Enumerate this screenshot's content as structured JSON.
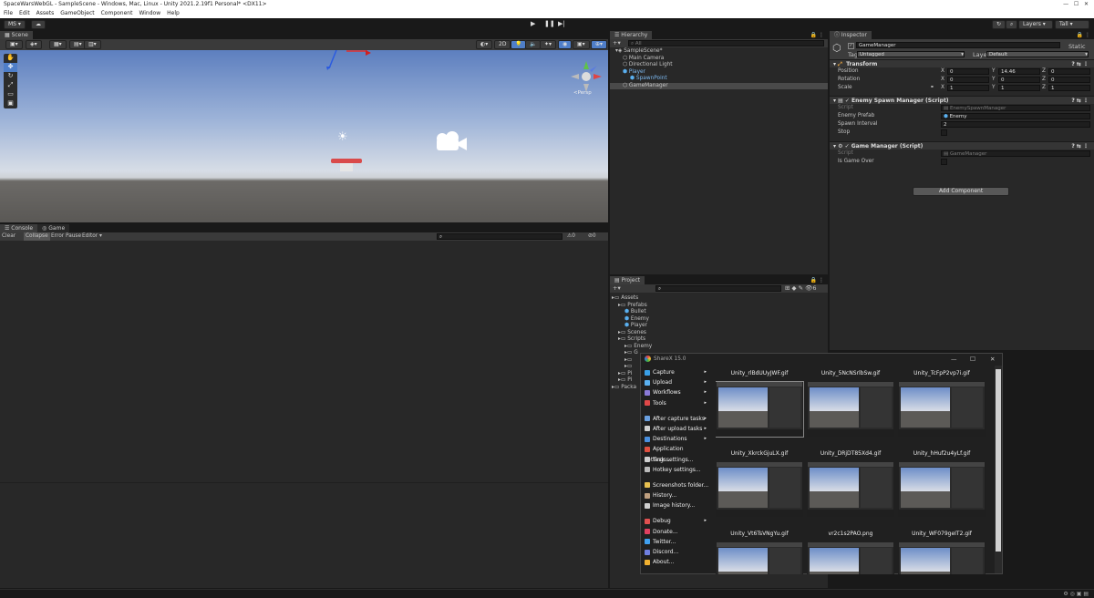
{
  "window": {
    "title": "SpaceWarsWebGL - SampleScene - Windows, Mac, Linux - Unity 2021.2.19f1 Personal* <DX11>"
  },
  "menubar": [
    "File",
    "Edit",
    "Assets",
    "GameObject",
    "Component",
    "Window",
    "Help"
  ],
  "toolbar": {
    "account": "MS",
    "layers": "Layers",
    "layout": "Tall"
  },
  "scene": {
    "tab": "Scene",
    "persp_label": "<Persp",
    "mode_2d": "2D",
    "gizmo_count": "6"
  },
  "console": {
    "tabs": [
      "Console",
      "Game"
    ],
    "buttons": [
      "Clear",
      "Collapse",
      "Error Pause",
      "Editor"
    ],
    "warn_count": "0",
    "error_count": "0"
  },
  "hierarchy": {
    "tab": "Hierarchy",
    "search_placeholder": "All",
    "items": [
      {
        "label": "SampleScene*",
        "indent": 0,
        "selected": false
      },
      {
        "label": "Main Camera",
        "indent": 1,
        "selected": false
      },
      {
        "label": "Directional Light",
        "indent": 1,
        "selected": false
      },
      {
        "label": "Player",
        "indent": 1,
        "selected": false,
        "prefab": true
      },
      {
        "label": "SpawnPoint",
        "indent": 2,
        "selected": false,
        "prefab": true
      },
      {
        "label": "GameManager",
        "indent": 1,
        "selected": true
      }
    ]
  },
  "project": {
    "tab": "Project",
    "badge": "6",
    "items": [
      {
        "label": "Assets",
        "indent": 0
      },
      {
        "label": "Prefabs",
        "indent": 1
      },
      {
        "label": "Bullet",
        "indent": 2
      },
      {
        "label": "Enemy",
        "indent": 2
      },
      {
        "label": "Player",
        "indent": 2
      },
      {
        "label": "Scenes",
        "indent": 1
      },
      {
        "label": "Scripts",
        "indent": 1
      },
      {
        "label": "Enemy",
        "indent": 2
      },
      {
        "label": "G",
        "indent": 2
      },
      {
        "label": "",
        "indent": 2
      },
      {
        "label": "",
        "indent": 2
      },
      {
        "label": "Pi",
        "indent": 1
      },
      {
        "label": "Pi",
        "indent": 1
      },
      {
        "label": "Packa",
        "indent": 0
      }
    ]
  },
  "inspector": {
    "tab": "Inspector",
    "object_name": "GameManager",
    "static_label": "Static",
    "tag_label": "Tag",
    "tag_value": "Untagged",
    "layer_label": "Layer",
    "layer_value": "Default",
    "transform": {
      "title": "Transform",
      "position": {
        "label": "Position",
        "x": "0",
        "y": "14.46",
        "z": "0"
      },
      "rotation": {
        "label": "Rotation",
        "x": "0",
        "y": "0",
        "z": "0"
      },
      "scale": {
        "label": "Scale",
        "x": "1",
        "y": "1",
        "z": "1"
      }
    },
    "enemy_spawn": {
      "title": "Enemy Spawn Manager (Script)",
      "script_label": "Script",
      "script_value": "EnemySpawnManager",
      "prefab_label": "Enemy Prefab",
      "prefab_value": "Enemy",
      "interval_label": "Spawn Interval",
      "interval_value": "2",
      "stop_label": "Stop"
    },
    "game_manager": {
      "title": "Game Manager (Script)",
      "script_label": "Script",
      "script_value": "GameManager",
      "gameover_label": "Is Game Over"
    },
    "add_component": "Add Component"
  },
  "sharex": {
    "title": "ShareX 15.0",
    "menu": [
      {
        "label": "Capture",
        "icon": "capture-icon",
        "color": "#3aa0e8",
        "arrow": true
      },
      {
        "label": "Upload",
        "icon": "upload-icon",
        "color": "#5ab0f0",
        "arrow": true
      },
      {
        "label": "Workflows",
        "icon": "workflows-icon",
        "color": "#8a7ad8",
        "arrow": true
      },
      {
        "label": "Tools",
        "icon": "tools-icon",
        "color": "#e04848",
        "arrow": true
      },
      {
        "label": "",
        "gap": true
      },
      {
        "label": "After capture tasks",
        "icon": "after-capture-icon",
        "color": "#6aa0e0",
        "arrow": true
      },
      {
        "label": "After upload tasks",
        "icon": "after-upload-icon",
        "color": "#d0d0d0",
        "arrow": true
      },
      {
        "label": "Destinations",
        "icon": "destinations-icon",
        "color": "#4a90e0",
        "arrow": true
      },
      {
        "label": "Application settings...",
        "icon": "app-settings-icon",
        "color": "#e05040",
        "arrow": false
      },
      {
        "label": "Task settings...",
        "icon": "task-settings-icon",
        "color": "#d0d0d0",
        "arrow": false
      },
      {
        "label": "Hotkey settings...",
        "icon": "hotkey-icon",
        "color": "#bbbbbb",
        "arrow": false
      },
      {
        "label": "",
        "gap": true
      },
      {
        "label": "Screenshots folder...",
        "icon": "folder-icon",
        "color": "#e8c050",
        "arrow": false
      },
      {
        "label": "History...",
        "icon": "history-icon",
        "color": "#c0a080",
        "arrow": false
      },
      {
        "label": "Image history...",
        "icon": "image-history-icon",
        "color": "#d0d0d0",
        "arrow": false
      },
      {
        "label": "",
        "gap": true
      },
      {
        "label": "Debug",
        "icon": "debug-icon",
        "color": "#e05050",
        "arrow": true
      },
      {
        "label": "Donate...",
        "icon": "donate-icon",
        "color": "#e04060",
        "arrow": false
      },
      {
        "label": "Twitter...",
        "icon": "twitter-icon",
        "color": "#40a0f0",
        "arrow": false
      },
      {
        "label": "Discord...",
        "icon": "discord-icon",
        "color": "#7080e0",
        "arrow": false
      },
      {
        "label": "About...",
        "icon": "about-icon",
        "color": "#f0b030",
        "arrow": false
      }
    ],
    "thumbnails": [
      "Unity_rlBdUUyJWF.gif",
      "Unity_5NcNSrlbSw.gif",
      "Unity_TcFpP2vp7i.gif",
      "Unity_XkrckGjuLX.gif",
      "Unity_DRjDT85Xd4.gif",
      "Unity_hHuf2u4yLf.gif",
      "Unity_Vt6TsVNgYu.gif",
      "vr2c1s2PAO.png",
      "Unity_WF079geIT2.gif"
    ]
  }
}
